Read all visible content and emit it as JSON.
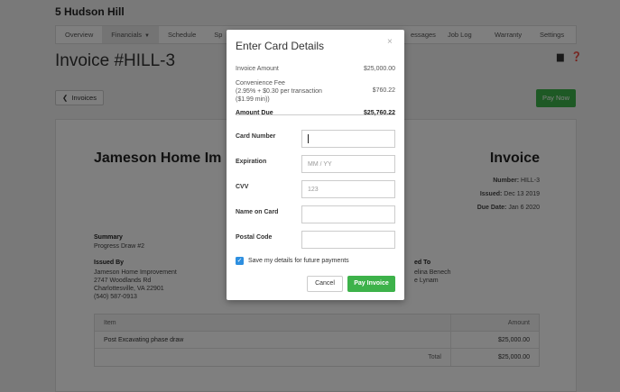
{
  "project": {
    "title": "5 Hudson Hill"
  },
  "tabs": [
    {
      "label": "Overview"
    },
    {
      "label": "Financials"
    },
    {
      "label": "Schedule"
    },
    {
      "label": "Sp"
    },
    {
      "label": "essages"
    },
    {
      "label": "Job Log"
    },
    {
      "label": "Warranty"
    },
    {
      "label": "Settings"
    }
  ],
  "page": {
    "title": "Invoice #HILL-3",
    "back_label": "Invoices",
    "pay_now_label": "Pay Now",
    "print_icon": "print-icon",
    "help_icon": "help-icon"
  },
  "document": {
    "company": "Jameson Home Im",
    "heading": "Invoice",
    "number_label": "Number:",
    "number_value": "HILL-3",
    "issued_label": "Issued:",
    "issued_value": "Dec 13 2019",
    "due_label": "Due Date:",
    "due_value": "Jan 6 2020",
    "summary_label": "Summary",
    "summary_value": "Progress Draw #2",
    "issued_by_label": "Issued By",
    "issued_by_lines": [
      "Jameson Home Improvement",
      "2747 Woodlands Rd",
      "Charlottesville, VA 22901",
      "(540) 587-0913"
    ],
    "issued_to_label": "ed To",
    "issued_to_lines": [
      "elina Benech",
      "e Lynam"
    ],
    "table": {
      "headers": [
        "Item",
        "Amount"
      ],
      "rows": [
        {
          "item": "Post Excavating phase draw",
          "amount": "$25,000.00"
        }
      ],
      "total_label": "Total",
      "total_value": "$25,000.00"
    }
  },
  "modal": {
    "title": "Enter Card Details",
    "close_glyph": "×",
    "invoice_amount_label": "Invoice Amount",
    "invoice_amount_value": "$25,000.00",
    "fee_label_1": "Convenience Fee",
    "fee_label_2": "(2.95% + $0.30 per transaction",
    "fee_label_3": "($1.99 min))",
    "fee_value": "$760.22",
    "amount_due_label": "Amount Due",
    "amount_due_value": "$25,760.22",
    "fields": {
      "card_number": {
        "label": "Card Number",
        "value": "",
        "placeholder": ""
      },
      "expiration": {
        "label": "Expiration",
        "value": "",
        "placeholder": "MM / YY"
      },
      "cvv": {
        "label": "CVV",
        "value": "",
        "placeholder": "123"
      },
      "name": {
        "label": "Name on Card",
        "value": "",
        "placeholder": ""
      },
      "postal": {
        "label": "Postal Code",
        "value": "",
        "placeholder": ""
      }
    },
    "save_label": "Save my details for future payments",
    "save_checked": true,
    "cancel_label": "Cancel",
    "pay_label": "Pay Invoice"
  },
  "colors": {
    "accent_green": "#3db24a",
    "checkbox_blue": "#2d8fe0",
    "overlay": "rgba(0,0,0,0.5)"
  }
}
